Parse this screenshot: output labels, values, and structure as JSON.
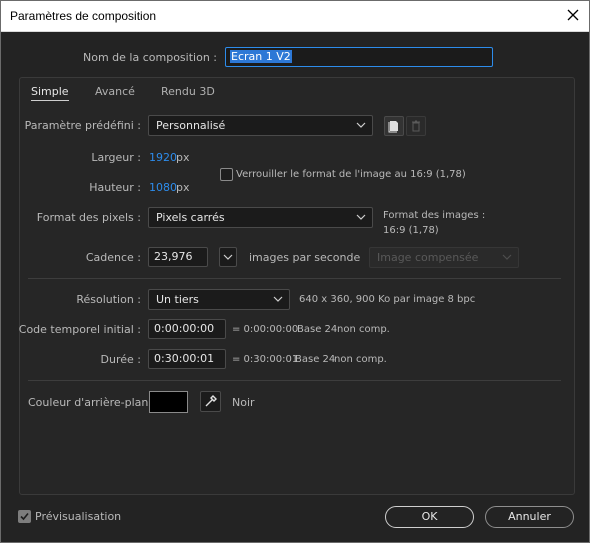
{
  "window": {
    "title": "Paramètres de composition"
  },
  "comp_name": {
    "label": "Nom de la composition :",
    "value": "Ecran 1 V2"
  },
  "tabs": [
    {
      "label": "Simple"
    },
    {
      "label": "Avancé"
    },
    {
      "label": "Rendu 3D"
    }
  ],
  "preset": {
    "label": "Paramètre prédéfini :",
    "value": "Personnalisé"
  },
  "width": {
    "label": "Largeur :",
    "value": "1920",
    "unit": "px"
  },
  "height": {
    "label": "Hauteur :",
    "value": "1080",
    "unit": "px"
  },
  "lock_aspect": {
    "label": "Verrouiller le format de l'image au 16:9 (1,78)",
    "checked": false
  },
  "pixel_format": {
    "label": "Format des pixels :",
    "value": "Pixels carrés",
    "image_format_label": "Format des images :",
    "image_format_value": "16:9 (1,78)"
  },
  "framerate": {
    "label": "Cadence :",
    "value": "23,976",
    "unit": "images par seconde",
    "mode": "Image compensée"
  },
  "resolution": {
    "label": "Résolution :",
    "value": "Un tiers",
    "info": "640 x 360, 900 Ko par image 8 bpc"
  },
  "start_timecode": {
    "label": "Code temporel initial :",
    "value": "0:00:00:00",
    "equals": "= 0:00:00:00",
    "base": "Base 24",
    "mode": "non comp."
  },
  "duration": {
    "label": "Durée :",
    "value": "0:30:00:01",
    "equals": "= 0:30:00:01",
    "base": "Base 24",
    "mode": "non comp."
  },
  "background": {
    "label": "Couleur d'arrière-plan :",
    "color_name": "Noir",
    "color": "#000000"
  },
  "preview": {
    "label": "Prévisualisation",
    "checked": true
  },
  "buttons": {
    "ok": "OK",
    "cancel": "Annuler"
  }
}
